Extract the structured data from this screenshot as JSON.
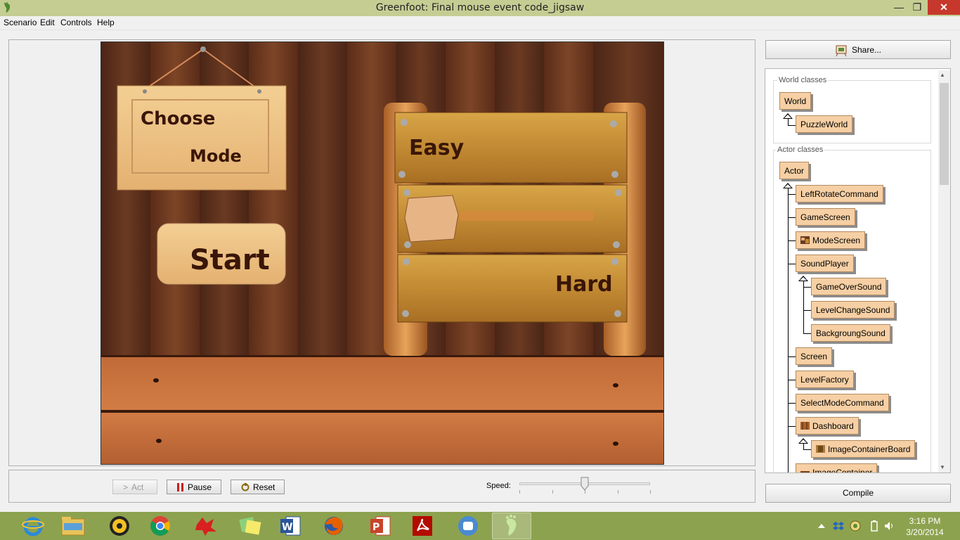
{
  "window": {
    "title": "Greenfoot: Final mouse event code_jigsaw",
    "minimize": "—",
    "maximize": "❐",
    "close": "✕"
  },
  "menu": [
    "Scenario",
    "Edit",
    "Controls",
    "Help"
  ],
  "world": {
    "sign_choose": "Choose",
    "sign_mode": "Mode",
    "start_label": "Start",
    "easy_label": "Easy",
    "hard_label": "Hard"
  },
  "controls": {
    "act": "Act",
    "pause": "Pause",
    "reset": "Reset",
    "speed_label": "Speed:",
    "speed_level": 0.5
  },
  "share_label": "Share...",
  "world_classes_label": "World classes",
  "actor_classes_label": "Actor classes",
  "world_classes": [
    "World",
    "PuzzleWorld"
  ],
  "actor_classes": [
    "Actor",
    "LeftRotateCommand",
    "GameScreen",
    "ModeScreen",
    "SoundPlayer",
    "GameOverSound",
    "LevelChangeSound",
    "BackgroungSound",
    "Screen",
    "LevelFactory",
    "SelectModeCommand",
    "Dashboard",
    "ImageContainerBoard",
    "ImageContainer"
  ],
  "compile_label": "Compile",
  "clock": {
    "time": "3:16 PM",
    "date": "3/20/2014"
  },
  "taskbar_apps": [
    "internet-explorer",
    "file-explorer",
    "media-player",
    "chrome",
    "paint",
    "sticky-notes",
    "word",
    "firefox",
    "powerpoint",
    "acrobat",
    "app",
    "greenfoot"
  ],
  "colors": {
    "titlebar": "#c5cd93",
    "taskbar": "#8da24e",
    "class_box": "#f6cfa4",
    "close_button": "#c7382c"
  }
}
